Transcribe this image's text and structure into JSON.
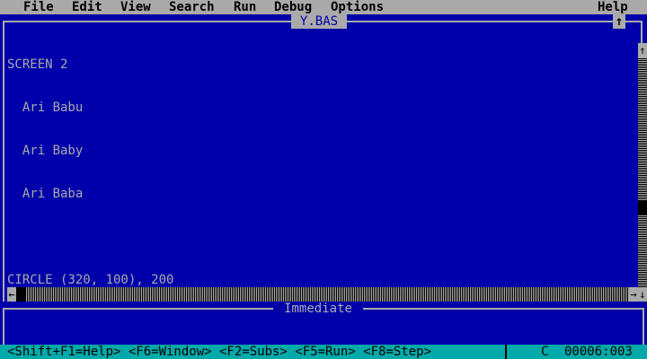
{
  "menu": {
    "items": [
      "File",
      "Edit",
      "View",
      "Search",
      "Run",
      "Debug",
      "Options"
    ],
    "help": "Help"
  },
  "editor": {
    "title": "Y.BAS",
    "maximize_glyph": "↑",
    "lines": [
      "SCREEN 2",
      "  Ari Babu",
      "  Ari Baby",
      "  Ari Baba",
      "",
      "CIRCLE (320, 100), 200"
    ],
    "scroll_up_glyph": "↑",
    "scroll_down_glyph": "↓",
    "scroll_left_glyph": "←",
    "scroll_right_glyph": "→"
  },
  "immediate": {
    "title": "Immediate"
  },
  "status": {
    "keys": "<Shift+F1=Help> <F6=Window> <F2=Subs> <F5=Run> <F8=Step>",
    "caps": "C",
    "position": "00006:003"
  },
  "colors": {
    "background": "#0000aa",
    "chrome": "#aaaaaa",
    "statusbar": "#00aaaa",
    "text": "#aaaaaa"
  }
}
